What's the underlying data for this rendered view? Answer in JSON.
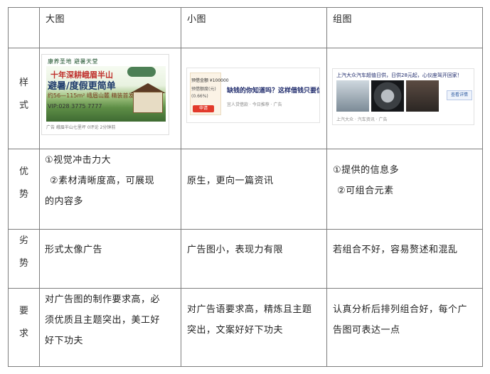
{
  "table": {
    "header": {
      "c1": "大图",
      "c2": "小图",
      "c3": "组图"
    },
    "rows": {
      "style": {
        "label_1": "样",
        "label_2": "式"
      },
      "pros": {
        "label_1": "优",
        "label_2": "势",
        "c1_line1": "①视觉冲击力大",
        "c1_line2": "②素材清晰度高，可展现",
        "c1_line3": "的内容多",
        "c2_line1": "原生，更向一篇资讯",
        "c3_line1": "①提供的信息多",
        "c3_line2": "②可组合元素"
      },
      "cons": {
        "label_1": "劣",
        "label_2": "势",
        "c1": "形式太像广告",
        "c2": "广告图小，表现力有限",
        "c3": "若组合不好，容易赘述和混乱"
      },
      "req": {
        "label_1": "要",
        "label_2": "求",
        "c1_line1": "对广告图的制作要求高，必",
        "c1_line2": "须优质且主题突出，美工好",
        "c1_line3": "好下功夫",
        "c2_line1": "对广告语要求高，精炼且主题",
        "c2_line2": "突出，文案好好下功夫",
        "c3_line1": "认真分析后排列组合好，每个广",
        "c3_line2": "告图可表达一点"
      }
    }
  },
  "big_ad": {
    "header": "康养圣地 避暑天堂",
    "line1": "十年深耕峨眉半山",
    "line2": "避暑/度假更简单",
    "line3": "约56—115m² 峨眉山麓 精装首发",
    "line4": "VIP:028 3775 7777",
    "footer": "广告  峨眉半山七里坪  0评论  2分钟前"
  },
  "small_ad": {
    "left_line1": "预借金额 ¥100000",
    "left_line2": "预借额度(元)",
    "left_line3": "(0.66%)",
    "button": "申请",
    "title": "缺钱的你知道吗？这样借钱只要信用卡就行",
    "footer": "宜人贷借款 · 今日推荐 · 广告"
  },
  "group_ad": {
    "title": "上汽大众汽车超值日供，日供28元起，心仪座驾开回家！",
    "cta": "查看详情",
    "footer": "上汽大众 · 汽车资讯 · 广告"
  }
}
